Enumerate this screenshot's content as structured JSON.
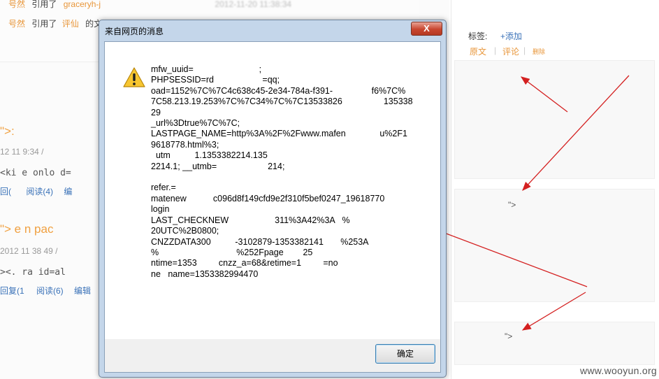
{
  "background": {
    "cite_rows": [
      {
        "user": "号然",
        "action": "引用了",
        "target": "graceryh-j",
        "time": "2012-11-20 11:38:34"
      },
      {
        "user": "号然",
        "action": "引用了",
        "target": "评仙",
        "suffix": "的文"
      }
    ],
    "post_fragments": {
      "title1": "\">:",
      "meta1": "12  11 9:34 /",
      "code1": "<ki   e onlo d=",
      "links1": [
        "回( ",
        "阅读(4)",
        "编"
      ],
      "title2": "\"> e  n pac",
      "meta2": "2012 11   38 49 /",
      "code2": "><. ra   id=al",
      "links2": [
        "回复(1",
        "阅读(6)",
        "编辑"
      ]
    }
  },
  "right_panel": {
    "tags_label": "标签:",
    "add_tag": "+添加",
    "tabs": [
      "原文",
      "评论",
      "删除"
    ],
    "snippet1": "\">",
    "snippet2": "\">",
    "watermark": "www.wooyun.org"
  },
  "dialog": {
    "title": "来自网页的消息",
    "close_label": "X",
    "message": "mfw_uuid=                           ;\nPHPSESSID=rd                    =qq;\noad=1152%7C%7C4c638c45-2e34-784a-f391-                f6%7C%\n7C58.213.19.253%7C%7C34%7C%7C13533826                 135338\n29                                             \n_url%3Dtrue%7C%7C;\nLASTPAGE_NAME=http%3A%2F%2Fwww.mafen              u%2F1\n9618778.html%3;\n  utm          1.1353382214.135\n2214.1; __utmb=                     214;\n \nrefer.=                          \nmatenew           c096d8f149cfd9e2f310f5bef0247_19618770\nlogin\nLAST_CHECKNEW                   311%3A42%3A   %\n20UTC%2B0800;\nCNZZDATA300          -3102879-1353382141       %253A\n%                                %252Fpage        25\nntime=1353         cnzz_a=68&retime=1         =no\nne   name=1353382994470",
    "ok_label": "确定"
  }
}
